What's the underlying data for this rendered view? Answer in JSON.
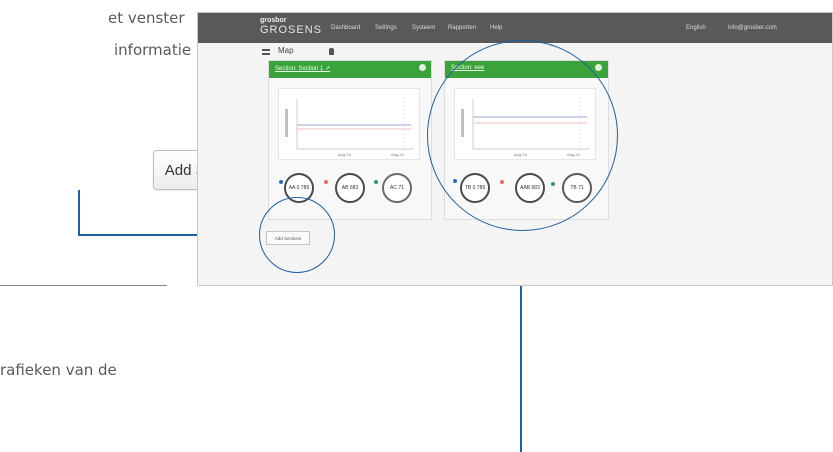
{
  "doc": {
    "text_line_1": "et venster",
    "text_line_2": "informatie",
    "text_line_3": "rafieken van de"
  },
  "callout": {
    "add_sections_label": "Add Sections"
  },
  "app": {
    "logo_top": "grosbor",
    "logo_main": "GROSENS",
    "nav": [
      "Dashboard",
      "Settings",
      "Systeem",
      "Rapporten",
      "Help"
    ],
    "language": "English",
    "user": "info@grosber.com",
    "toolbar_text": "Map",
    "panels": [
      {
        "title": "Section: Section 1 ↗"
      },
      {
        "title": "Section: eee"
      }
    ],
    "panel1_gauges": [
      "AA 0.789",
      "AB 683",
      "AC 71"
    ],
    "panel2_gauges": [
      "TB 0.789",
      "AAB 683",
      "TB 71"
    ],
    "panel1_xticks": [
      "Aug 23",
      "Aug 24"
    ],
    "panel2_xticks": [
      "Aug 23",
      "Aug 24"
    ],
    "add_sections_small": "Add Sections"
  },
  "colors": {
    "accent_blue": "#1f5fa4",
    "panel_green": "#3aa33b",
    "topbar": "#595959"
  }
}
